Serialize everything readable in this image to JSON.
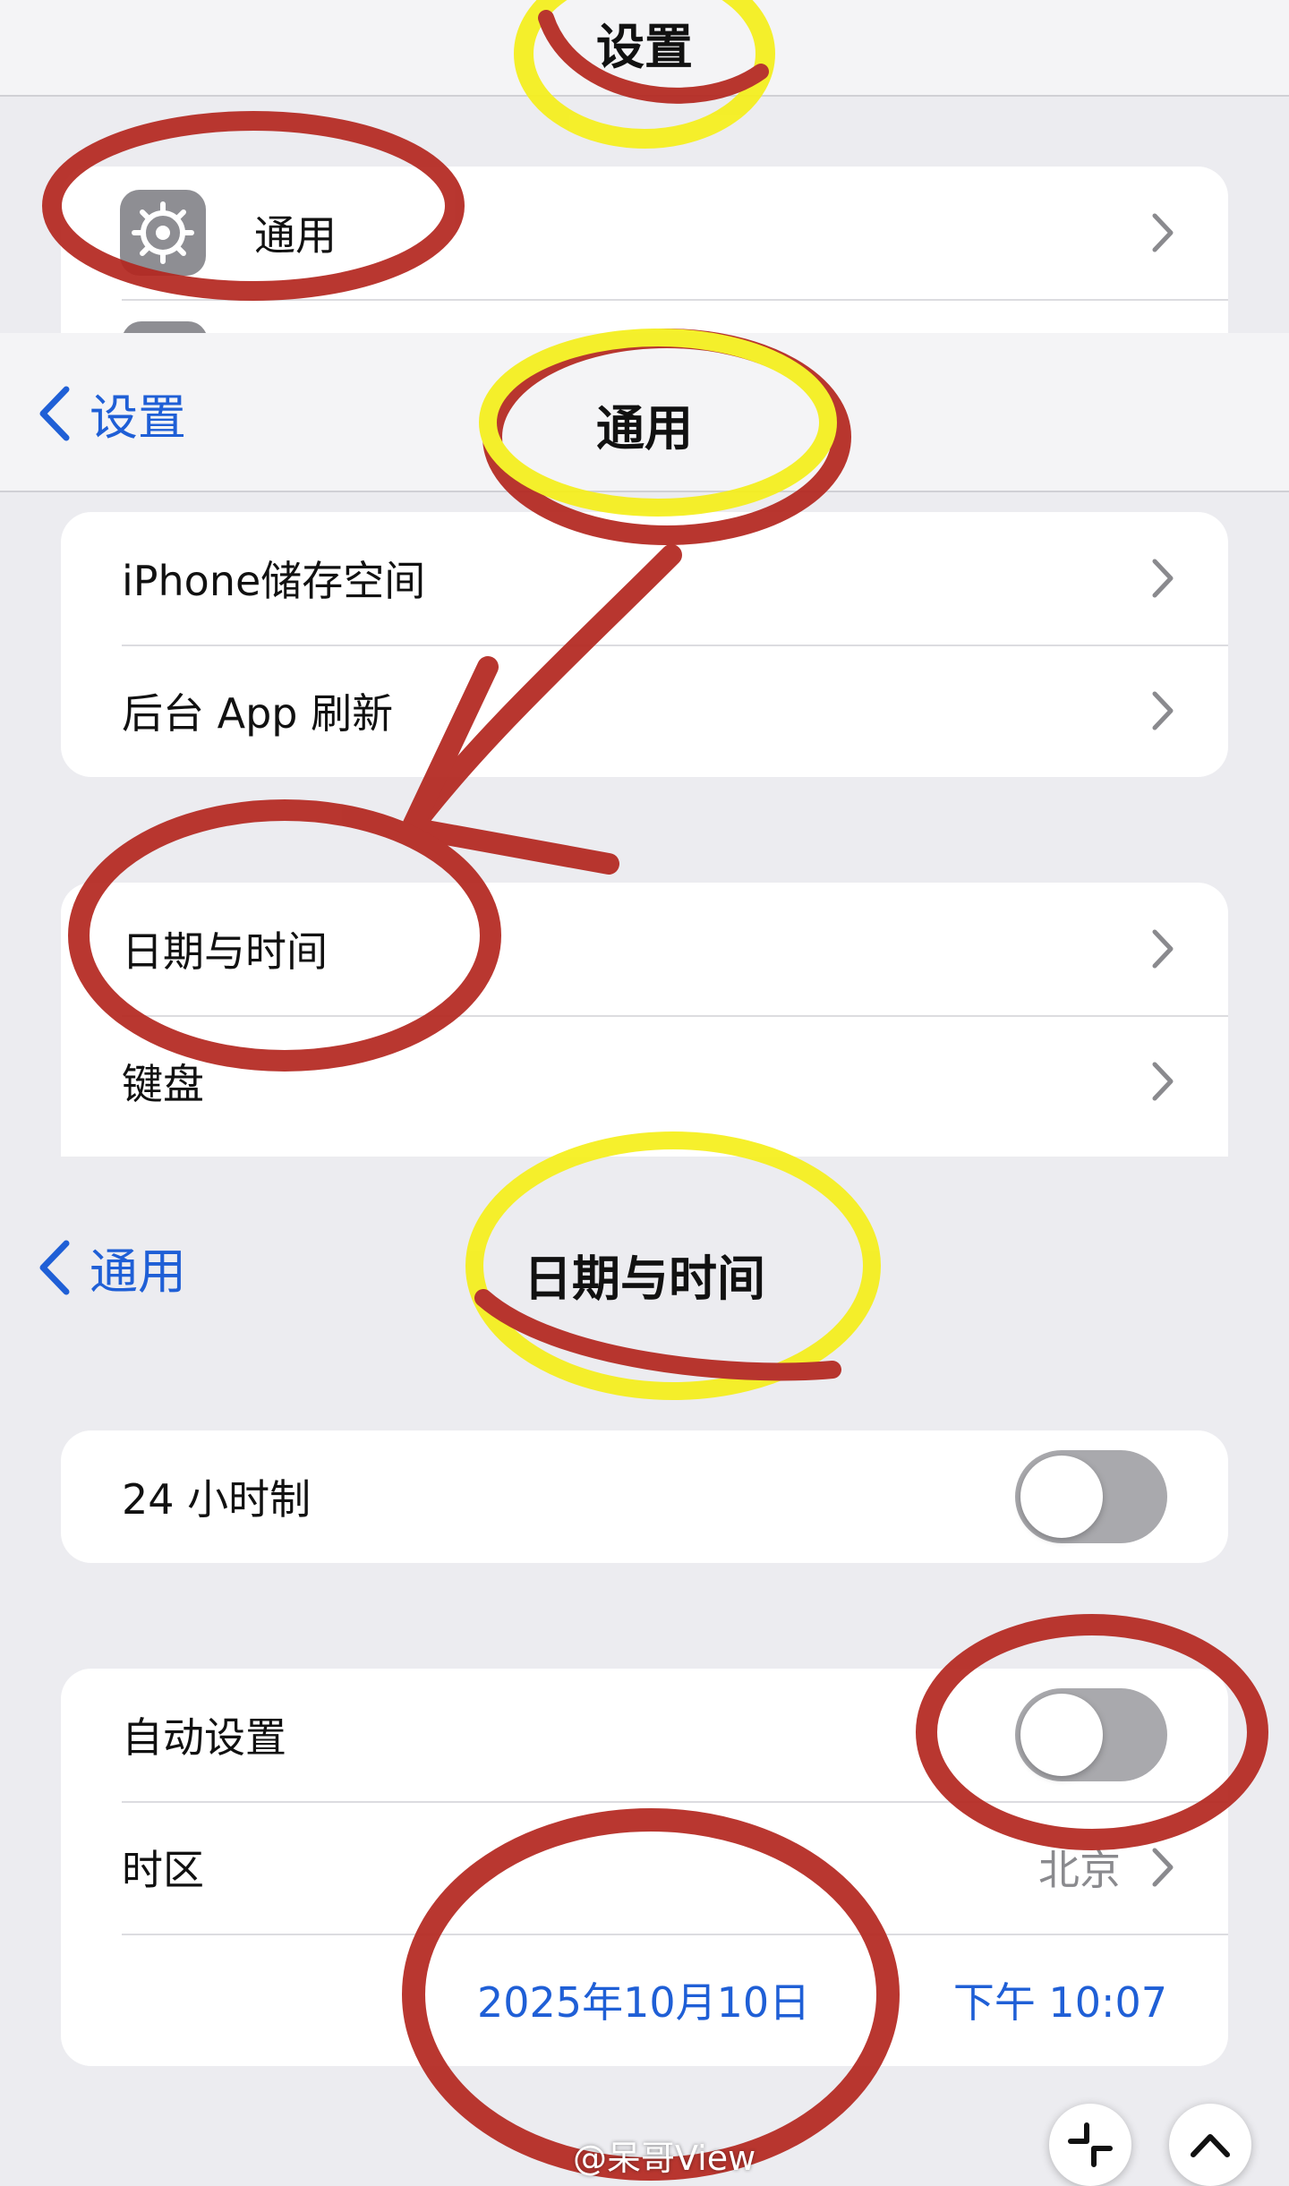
{
  "screen1": {
    "title": "设置",
    "general_label": "通用"
  },
  "screen2": {
    "back_label": "设置",
    "title": "通用",
    "group1": [
      "iPhone储存空间",
      "后台 App 刷新"
    ],
    "group2": [
      "日期与时间",
      "键盘"
    ]
  },
  "screen3": {
    "back_label": "通用",
    "title": "日期与时间",
    "hour24_label": "24 小时制",
    "hour24_on": false,
    "auto_set_label": "自动设置",
    "auto_set_on": false,
    "timezone_label": "时区",
    "timezone_value": "北京",
    "date_value": "2025年10月10日",
    "time_value": "下午 10:07"
  },
  "watermark": "@呆哥View",
  "colors": {
    "link_blue": "#1f5fd6",
    "annotation_red": "#b3261e",
    "annotation_yellow": "#f5ef1a"
  },
  "icons": [
    "gear-icon",
    "chevron-right-icon",
    "chevron-left-icon",
    "collapse-icon",
    "chevron-up-icon"
  ]
}
